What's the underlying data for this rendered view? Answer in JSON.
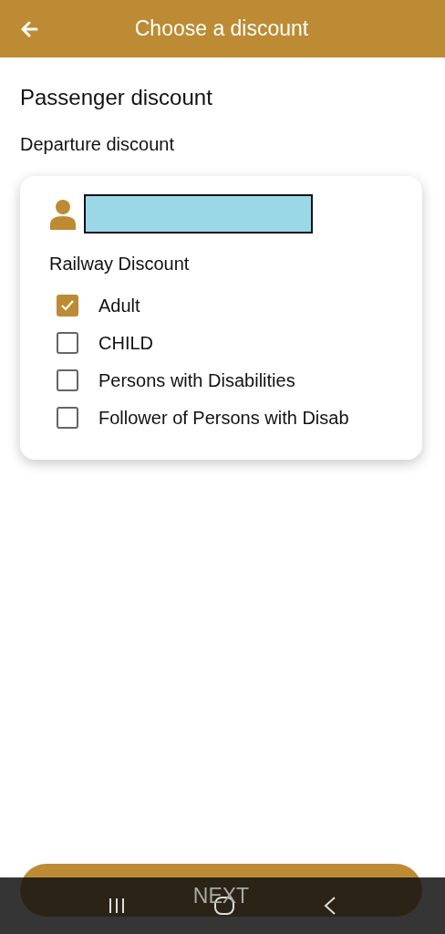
{
  "app_bar": {
    "title": "Choose a discount"
  },
  "heading": "Passenger discount",
  "subheading": "Departure discount",
  "passenger_card": {
    "section_title": "Railway Discount",
    "options": [
      {
        "label": "Adult",
        "checked": true
      },
      {
        "label": "CHILD",
        "checked": false
      },
      {
        "label": "Persons with Disabilities",
        "checked": false
      },
      {
        "label": "Follower of Persons with Disab",
        "checked": false
      }
    ]
  },
  "next_button": {
    "label": "NEXT"
  }
}
